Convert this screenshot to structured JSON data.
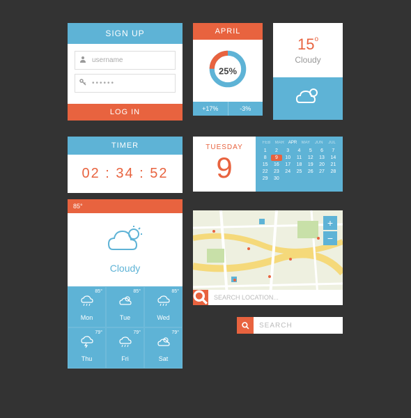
{
  "signup": {
    "title": "SIGN UP",
    "username_placeholder": "username",
    "password_mask": "••••••",
    "login_label": "LOG IN"
  },
  "april": {
    "title": "APRIL",
    "percent": "25%",
    "up": "+17%",
    "down": "-3%"
  },
  "small_weather": {
    "temp": "15",
    "deg": "o",
    "cond": "Cloudy"
  },
  "timer": {
    "title": "TIMER",
    "value": "02 : 34 : 52"
  },
  "calendar": {
    "day_name": "TUESDAY",
    "day_num": "9",
    "months": [
      "FEB",
      "MAR",
      "APR",
      "MAY",
      "JUN",
      "JUL"
    ],
    "current_month_idx": 2,
    "days": [
      1,
      2,
      3,
      4,
      5,
      6,
      7,
      8,
      9,
      10,
      11,
      12,
      13,
      14,
      15,
      16,
      17,
      18,
      19,
      20,
      21,
      22,
      23,
      24,
      25,
      26,
      27,
      28,
      29,
      30
    ],
    "selected": 9
  },
  "big_weather": {
    "head_temp": "85°",
    "cond": "Cloudy",
    "cells": [
      {
        "t": "85°",
        "d": "Mon",
        "icon": "rain"
      },
      {
        "t": "85°",
        "d": "Tue",
        "icon": "sunny"
      },
      {
        "t": "85°",
        "d": "Wed",
        "icon": "rain"
      },
      {
        "t": "79°",
        "d": "Thu",
        "icon": "storm"
      },
      {
        "t": "79°",
        "d": "Fri",
        "icon": "rain"
      },
      {
        "t": "79°",
        "d": "Sat",
        "icon": "sunny"
      }
    ]
  },
  "map": {
    "zoom_in": "+",
    "zoom_out": "−",
    "search_placeholder": "SEARCH LOCATION..."
  },
  "search": {
    "placeholder": "SEARCH"
  }
}
